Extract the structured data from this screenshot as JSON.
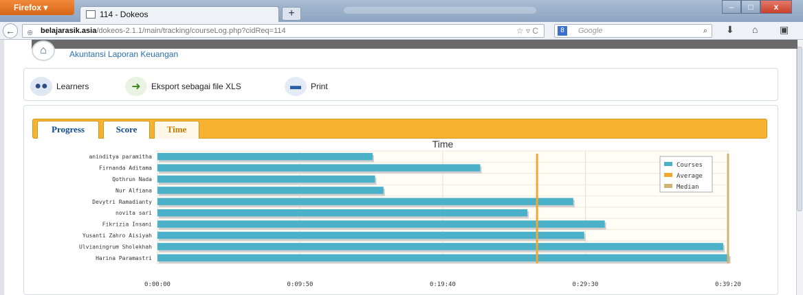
{
  "browser": {
    "app_button": "Firefox",
    "tab_title": "114 - Dokeos",
    "new_tab": "+",
    "url_host": "belajarasik.asia",
    "url_path": "/dokeos-2.1.1/main/tracking/courseLog.php?cidReq=114",
    "search_placeholder": "Google",
    "close_symbol": "x"
  },
  "header": {
    "course_title": "Akuntansi Laporan Keuangan"
  },
  "toolbar": {
    "learners_label": "Learners",
    "export_label": "Eksport sebagai file XLS",
    "print_label": "Print"
  },
  "tabs": [
    {
      "label": "Progress"
    },
    {
      "label": "Score"
    },
    {
      "label": "Time"
    }
  ],
  "chart_data": {
    "type": "bar",
    "orientation": "horizontal",
    "title": "Time",
    "categories": [
      "aninditya paramitha",
      "Firnanda Aditama",
      "Qothrun Nada",
      "Nur Alfiana",
      "Devytri Ramadianty",
      "novita sari",
      "Fikrizia Insani",
      "Yusanti Zahro Aisiyah",
      "Ulvianingrum Sholekhah",
      "Harina Paramastri"
    ],
    "series": [
      {
        "name": "Courses",
        "color": "#4bb1c9",
        "values": [
          890,
          1335,
          900,
          935,
          1720,
          1530,
          1850,
          1765,
          2340,
          2365
        ]
      }
    ],
    "reference_lines": [
      {
        "name": "Average",
        "value": 1570,
        "color": "#f0a830"
      },
      {
        "name": "Median",
        "value": 2360,
        "color": "#d4b474"
      }
    ],
    "x_ticks": [
      "0:00:00",
      "0:09:50",
      "0:19:40",
      "0:29:30",
      "0:39:20"
    ],
    "x_tick_values": [
      0,
      590,
      1180,
      1770,
      2360
    ],
    "xlim": [
      0,
      2360
    ],
    "legend": [
      {
        "label": "Courses",
        "color": "#4bb1c9"
      },
      {
        "label": "Average",
        "color": "#f0a830"
      },
      {
        "label": "Median",
        "color": "#d4b474"
      }
    ],
    "legend_position": "top-right",
    "grid": true
  }
}
